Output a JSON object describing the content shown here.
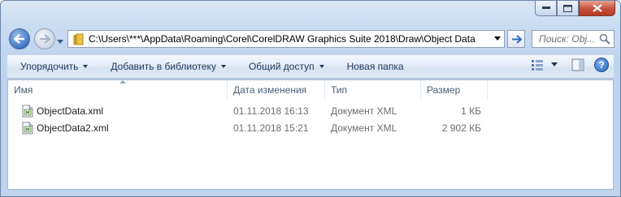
{
  "window": {
    "caption_buttons": [
      "minimize",
      "maximize",
      "close"
    ]
  },
  "nav": {
    "address_path": "C:\\Users\\***\\AppData\\Roaming\\Corel\\CorelDRAW Graphics Suite 2018\\Draw\\Object Data",
    "search_placeholder": "Поиск: Obj..."
  },
  "toolbar": {
    "organize": "Упорядочить",
    "add_to_library": "Добавить в библиотеку",
    "share": "Общий доступ",
    "new_folder": "Новая папка",
    "help": "?"
  },
  "columns": {
    "name": "Имя",
    "date": "Дата изменения",
    "type": "Тип",
    "size": "Размер"
  },
  "files": [
    {
      "name": "ObjectData.xml",
      "date": "01.11.2018 16:13",
      "type": "Документ XML",
      "size": "1 КБ"
    },
    {
      "name": "ObjectData2.xml",
      "date": "01.11.2018 15:21",
      "type": "Документ XML",
      "size": "2 902 КБ"
    }
  ],
  "colors": {
    "frame": "#bfd4ee",
    "toolbar_text": "#1e395b",
    "header_text": "#4c607a",
    "secondary_text": "#6d6d6d"
  }
}
